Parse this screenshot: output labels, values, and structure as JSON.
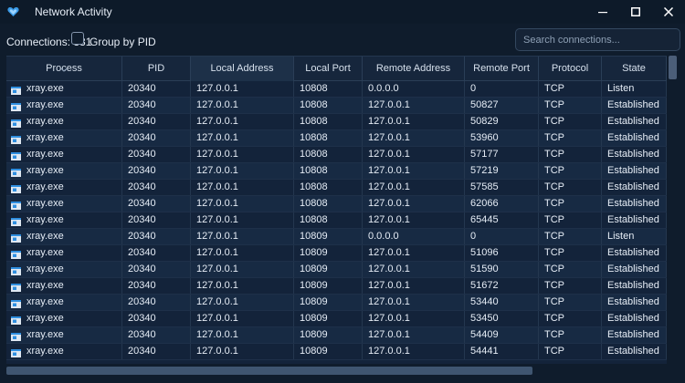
{
  "window": {
    "title": "Network Activity",
    "icon": "heart-shield-icon",
    "controls": [
      "minimize-icon",
      "maximize-icon",
      "close-icon"
    ]
  },
  "toolbar": {
    "connections_label": "Connections: 331",
    "group_by_pid_label": "Group by PID",
    "group_by_pid_checked": false,
    "search_placeholder": "Search connections...",
    "search_value": ""
  },
  "table": {
    "columns": [
      "Process",
      "PID",
      "Local Address",
      "Local Port",
      "Remote Address",
      "Remote Port",
      "Protocol",
      "State"
    ],
    "sorted_column": "Local Address",
    "rows": [
      [
        "xray.exe",
        "20340",
        "127.0.0.1",
        "10808",
        "0.0.0.0",
        "0",
        "TCP",
        "Listen"
      ],
      [
        "xray.exe",
        "20340",
        "127.0.0.1",
        "10808",
        "127.0.0.1",
        "50827",
        "TCP",
        "Established"
      ],
      [
        "xray.exe",
        "20340",
        "127.0.0.1",
        "10808",
        "127.0.0.1",
        "50829",
        "TCP",
        "Established"
      ],
      [
        "xray.exe",
        "20340",
        "127.0.0.1",
        "10808",
        "127.0.0.1",
        "53960",
        "TCP",
        "Established"
      ],
      [
        "xray.exe",
        "20340",
        "127.0.0.1",
        "10808",
        "127.0.0.1",
        "57177",
        "TCP",
        "Established"
      ],
      [
        "xray.exe",
        "20340",
        "127.0.0.1",
        "10808",
        "127.0.0.1",
        "57219",
        "TCP",
        "Established"
      ],
      [
        "xray.exe",
        "20340",
        "127.0.0.1",
        "10808",
        "127.0.0.1",
        "57585",
        "TCP",
        "Established"
      ],
      [
        "xray.exe",
        "20340",
        "127.0.0.1",
        "10808",
        "127.0.0.1",
        "62066",
        "TCP",
        "Established"
      ],
      [
        "xray.exe",
        "20340",
        "127.0.0.1",
        "10808",
        "127.0.0.1",
        "65445",
        "TCP",
        "Established"
      ],
      [
        "xray.exe",
        "20340",
        "127.0.0.1",
        "10809",
        "0.0.0.0",
        "0",
        "TCP",
        "Listen"
      ],
      [
        "xray.exe",
        "20340",
        "127.0.0.1",
        "10809",
        "127.0.0.1",
        "51096",
        "TCP",
        "Established"
      ],
      [
        "xray.exe",
        "20340",
        "127.0.0.1",
        "10809",
        "127.0.0.1",
        "51590",
        "TCP",
        "Established"
      ],
      [
        "xray.exe",
        "20340",
        "127.0.0.1",
        "10809",
        "127.0.0.1",
        "51672",
        "TCP",
        "Established"
      ],
      [
        "xray.exe",
        "20340",
        "127.0.0.1",
        "10809",
        "127.0.0.1",
        "53440",
        "TCP",
        "Established"
      ],
      [
        "xray.exe",
        "20340",
        "127.0.0.1",
        "10809",
        "127.0.0.1",
        "53450",
        "TCP",
        "Established"
      ],
      [
        "xray.exe",
        "20340",
        "127.0.0.1",
        "10809",
        "127.0.0.1",
        "54409",
        "TCP",
        "Established"
      ],
      [
        "xray.exe",
        "20340",
        "127.0.0.1",
        "10809",
        "127.0.0.1",
        "54441",
        "TCP",
        "Established"
      ]
    ]
  },
  "colors": {
    "background": "#0f1c2c",
    "row_alt": "#172a43",
    "accent": "#2f8fe0"
  }
}
